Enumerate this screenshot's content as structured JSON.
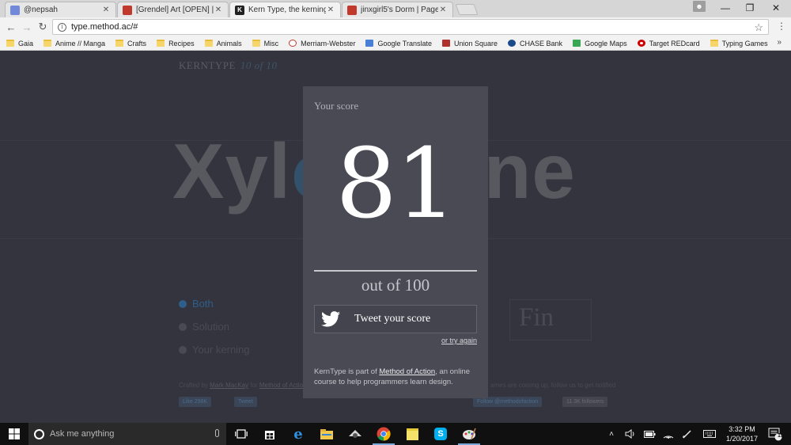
{
  "browser": {
    "tabs": [
      {
        "title": "@nepsah",
        "favicon_color": "#7289da",
        "active": false
      },
      {
        "title": "[Grendel] Art [OPEN] | Pa",
        "favicon_color": "#c0392b",
        "active": false
      },
      {
        "title": "Kern Type, the kerning g",
        "favicon_color": "#222222",
        "favicon_letter": "K",
        "active": true
      },
      {
        "title": "jinxgirl5's Dorm | Page 2",
        "favicon_color": "#c0392b",
        "active": false
      }
    ],
    "url": "type.method.ac/#",
    "bookmarks": [
      {
        "label": "Gaia",
        "icon": "folder-icon"
      },
      {
        "label": "Anime // Manga",
        "icon": "folder-icon"
      },
      {
        "label": "Crafts",
        "icon": "folder-icon"
      },
      {
        "label": "Recipes",
        "icon": "folder-icon"
      },
      {
        "label": "Animals",
        "icon": "folder-icon"
      },
      {
        "label": "Misc",
        "icon": "folder-icon"
      },
      {
        "label": "Merriam-Webster",
        "icon": "merriam-webster-icon"
      },
      {
        "label": "Google Translate",
        "icon": "google-translate-icon"
      },
      {
        "label": "Union Square",
        "icon": "union-square-icon"
      },
      {
        "label": "CHASE Bank",
        "icon": "chase-icon"
      },
      {
        "label": "Google Maps",
        "icon": "google-maps-icon"
      },
      {
        "label": "Target REDcard",
        "icon": "target-icon"
      },
      {
        "label": "Typing Games",
        "icon": "folder-icon"
      }
    ],
    "bookmarks_more": "»"
  },
  "page": {
    "brand": "KERNTYPE",
    "progress": "10 of 10",
    "word_left": "Xyl",
    "word_mid": "o",
    "word_right": "phone",
    "options": [
      {
        "label": "Both",
        "selected": true
      },
      {
        "label": "Solution",
        "selected": false
      },
      {
        "label": "Your kerning",
        "selected": false
      }
    ],
    "finish_label": "Fin",
    "credits_prefix": "Crafted by ",
    "credits_author": "Mark MacKay",
    "credits_mid": " for ",
    "credits_org": "Method of Action",
    "coming_soon": "ames are coming up, follow us to get notified",
    "like_label": "Like 298K",
    "tweet_label": "Tweet",
    "follow_label": "Follow @methodofaction",
    "followers_label": "11.3K followers"
  },
  "modal": {
    "heading": "Your score",
    "score": "81",
    "out_of": "out of 100",
    "tweet_button": "Tweet your score",
    "try_again": "or try again",
    "footnote_prefix": "KernType is part of ",
    "footnote_link": "Method of Action",
    "footnote_suffix": ", an online course to help programmers learn design."
  },
  "taskbar": {
    "search_placeholder": "Ask me anything",
    "time": "3:32 PM",
    "date": "1/20/2017",
    "notification_count": "13"
  },
  "colors": {
    "page_bg": "#34343e",
    "modal_bg": "#4a4a54",
    "accent_blue": "#2f5e8a"
  }
}
